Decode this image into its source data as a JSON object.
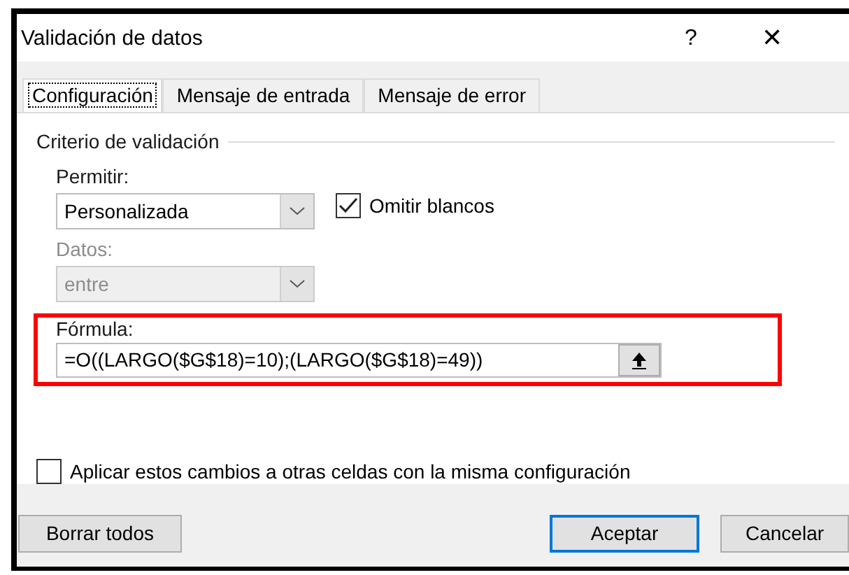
{
  "window": {
    "title": "Validación de datos",
    "help": "?",
    "close": "✕"
  },
  "tabs": [
    {
      "label": "Configuración",
      "selected": true
    },
    {
      "label": "Mensaje de entrada",
      "selected": false
    },
    {
      "label": "Mensaje de error",
      "selected": false
    }
  ],
  "group": {
    "title": "Criterio de validación"
  },
  "permitir": {
    "label": "Permitir:",
    "value": "Personalizada",
    "disabled": false
  },
  "omitir_blancos": {
    "label": "Omitir blancos",
    "checked": true
  },
  "datos": {
    "label": "Datos:",
    "value": "entre",
    "disabled": true
  },
  "formula": {
    "label": "Fórmula:",
    "value": "=O((LARGO($G$18)=10);(LARGO($G$18)=49))"
  },
  "aplicar": {
    "label": "Aplicar estos cambios a otras celdas con la misma configuración",
    "checked": false
  },
  "buttons": [
    {
      "label": "Borrar todos",
      "default": false
    },
    {
      "label": "Aceptar",
      "default": true
    },
    {
      "label": "Cancelar",
      "default": false
    }
  ]
}
